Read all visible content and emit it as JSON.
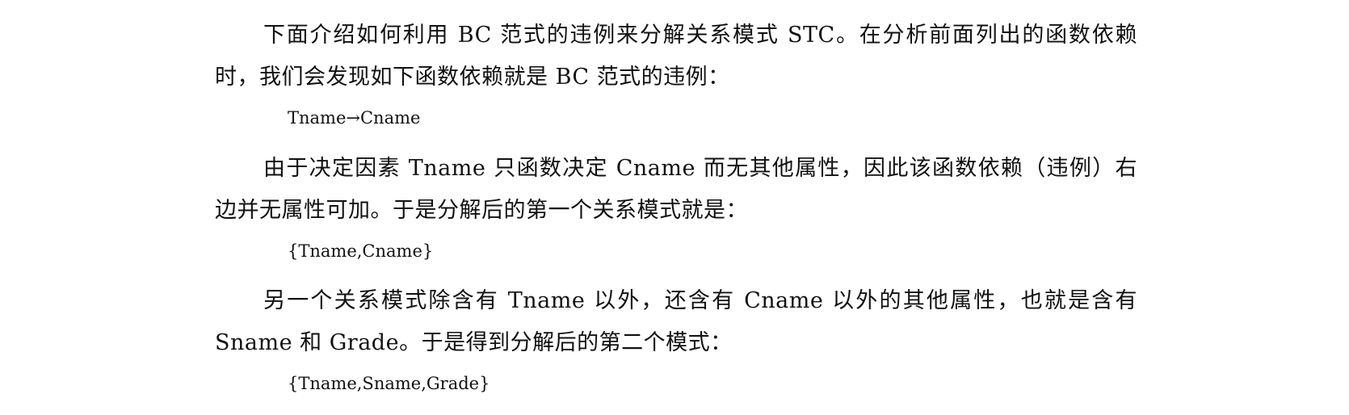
{
  "content": {
    "paragraph_1": "下面介绍如何利用 BC 范式的违例来分解关系模式 STC。在分析前面列出的函数依赖时，我们会发现如下函数依赖就是 BC 范式的违例：",
    "formula_1": "Tname→Cname",
    "paragraph_2": "由于决定因素 Tname 只函数决定 Cname 而无其他属性，因此该函数依赖（违例）右边并无属性可加。于是分解后的第一个关系模式就是：",
    "formula_2": "{Tname,Cname}",
    "paragraph_3": "另一个关系模式除含有 Tname 以外，还含有 Cname 以外的其他属性，也就是含有 Sname 和 Grade。于是得到分解后的第二个模式：",
    "formula_3": "{Tname,Sname,Grade}"
  }
}
